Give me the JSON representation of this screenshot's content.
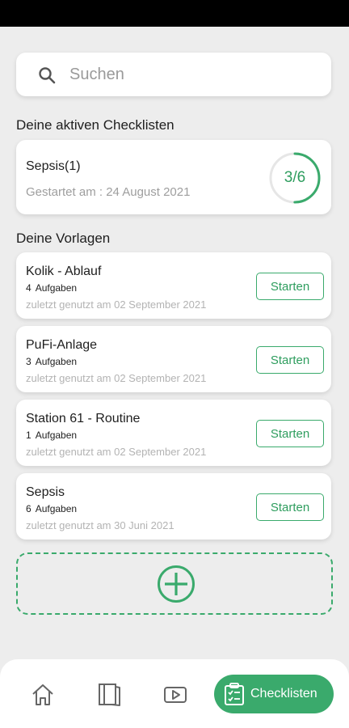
{
  "search": {
    "placeholder": "Suchen"
  },
  "active_section": {
    "title": "Deine aktiven Checklisten",
    "items": [
      {
        "name": "Sepsis(1)",
        "started": "Gestartet am : 24 August 2021",
        "progress_label": "3/6",
        "progress_fraction": 0.5
      }
    ]
  },
  "templates_section": {
    "title": "Deine Vorlagen",
    "items": [
      {
        "name": "Kolik - Ablauf",
        "count": "4",
        "count_label": "Aufgaben",
        "last_used": "zuletzt genutzt am  02 September 2021",
        "button": "Starten"
      },
      {
        "name": "PuFi-Anlage",
        "count": "3",
        "count_label": "Aufgaben",
        "last_used": "zuletzt genutzt am  02 September 2021",
        "button": "Starten"
      },
      {
        "name": "Station 61 - Routine",
        "count": "1",
        "count_label": "Aufgaben",
        "last_used": "zuletzt genutzt am  02 September 2021",
        "button": "Starten"
      },
      {
        "name": "Sepsis",
        "count": "6",
        "count_label": "Aufgaben",
        "last_used": "zuletzt genutzt am  30 Juni 2021",
        "button": "Starten"
      }
    ]
  },
  "nav": {
    "items": [
      {
        "icon": "home-icon"
      },
      {
        "icon": "book-icon"
      },
      {
        "icon": "video-icon"
      }
    ],
    "active_label": "Checklisten",
    "active_icon": "clipboard-checklist-icon"
  },
  "colors": {
    "accent": "#3aaa6c",
    "accent_text": "#2e9d5e"
  }
}
